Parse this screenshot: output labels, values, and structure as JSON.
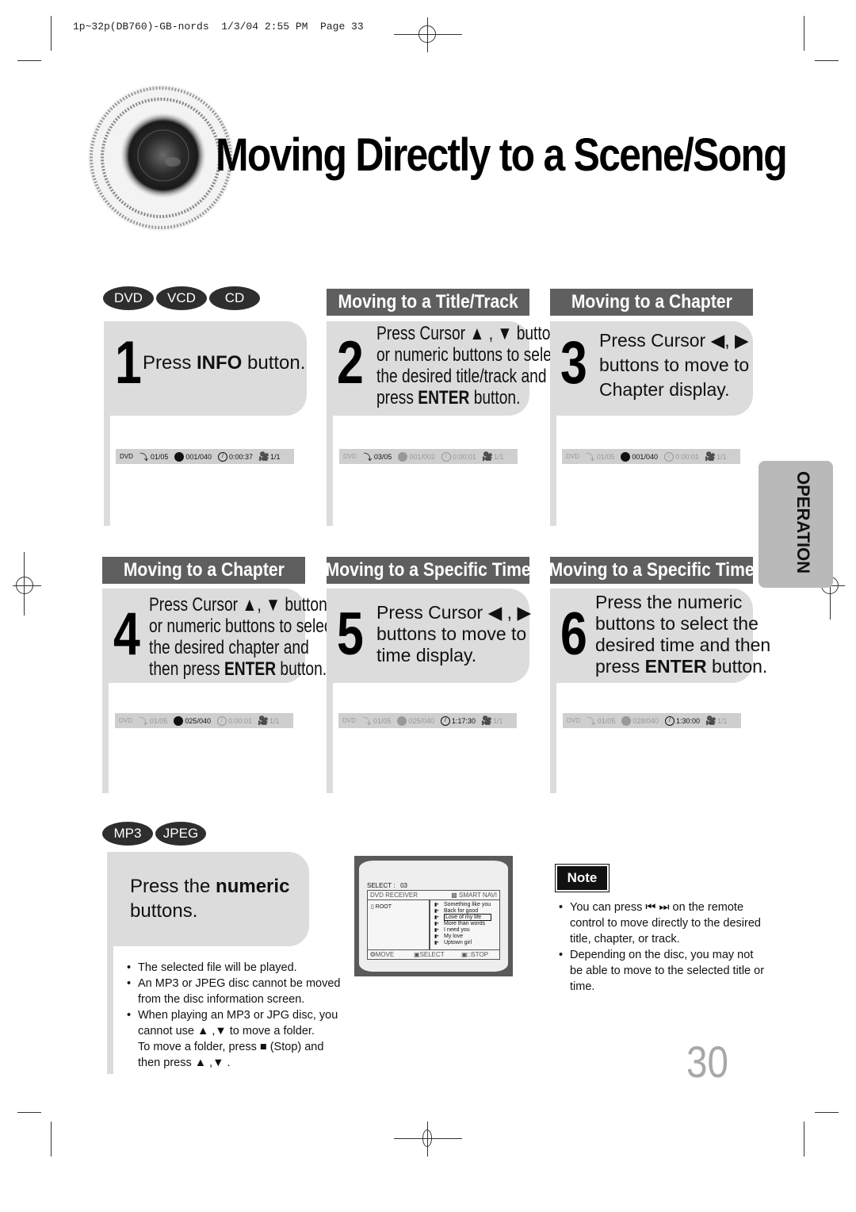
{
  "print_header": "1p~32p(DB760)-GB-nords  1/3/04 2:55 PM  Page 33",
  "page_title": "Moving Directly to a Scene/Song",
  "side_tab": "OPERATION",
  "page_number": "30",
  "disc_types_top": [
    "DVD",
    "VCD",
    "CD"
  ],
  "disc_types_bottom": [
    "MP3",
    "JPEG"
  ],
  "sections": {
    "title_track": "Moving to a Title/Track",
    "chapter_a": "Moving to a Chapter",
    "chapter_b": "Moving to a Chapter",
    "time_a": "Moving to a Specific Time",
    "time_b": "Moving to a Specific Time"
  },
  "steps": [
    {
      "num": "1",
      "pre": "Press ",
      "bold": "INFO",
      "post": " button."
    },
    {
      "num": "2",
      "line1": "Press Cursor ▲ , ▼ buttons",
      "line2": "or numeric buttons to select",
      "line3": "the desired title/track and then",
      "line4_pre": "press ",
      "line4_bold": "ENTER",
      "line4_post": " button."
    },
    {
      "num": "3",
      "line1": "Press Cursor ◀, ▶",
      "line2": "buttons to move to",
      "line3": "Chapter display."
    },
    {
      "num": "4",
      "line1": "Press Cursor ▲, ▼ buttons",
      "line2": "or numeric buttons to select",
      "line3": "the desired chapter and",
      "line4_pre": "then press ",
      "line4_bold": "ENTER",
      "line4_post": " button."
    },
    {
      "num": "5",
      "line1": "Press Cursor ◀ , ▶",
      "line2": "buttons to move to",
      "line3": "time display."
    },
    {
      "num": "6",
      "line1": "Press the numeric",
      "line2": "buttons to select the",
      "line3": "desired time and then",
      "line4_pre": "press ",
      "line4_bold": "ENTER",
      "line4_post": " button."
    }
  ],
  "osd": [
    {
      "disc": "DVD",
      "title": "01/05",
      "chapter": "001/040",
      "time": "0:00:37",
      "angle": "1/1",
      "active": "all"
    },
    {
      "disc": "DVD",
      "title": "03/05",
      "chapter": "001/002",
      "time": "0:00:01",
      "angle": "1/1",
      "active": "title"
    },
    {
      "disc": "DVD",
      "title": "01/05",
      "chapter": "001/040",
      "time": "0:00:01",
      "angle": "1/1",
      "active": "chapter"
    },
    {
      "disc": "DVD",
      "title": "01/05",
      "chapter": "025/040",
      "time": "0:00:01",
      "angle": "1/1",
      "active": "chapter"
    },
    {
      "disc": "DVD",
      "title": "01/05",
      "chapter": "025/040",
      "time": "1:17:30",
      "angle": "1/1",
      "active": "time"
    },
    {
      "disc": "DVD",
      "title": "01/05",
      "chapter": "028/040",
      "time": "1:30:00",
      "angle": "1/1",
      "active": "time"
    }
  ],
  "mp3_step": {
    "pre": "Press the ",
    "bold": "numeric",
    "line2": "buttons."
  },
  "mp3_screen": {
    "select_label": "SELECT :",
    "select_value": "03",
    "header_left": "DVD RECEIVER",
    "header_right": "SMART NAVI",
    "folder": "ROOT",
    "tracks": [
      "Something like you",
      "Back for good",
      "Love of my life",
      "More than words",
      "I need you",
      "My love",
      "Uptown girl"
    ],
    "selected_index": 2,
    "footer_move": "MOVE",
    "footer_select": "SELECT",
    "footer_stop": "STOP"
  },
  "mp3_bullets": {
    "b1": "The selected file will be played.",
    "b2_l1": "An MP3 or JPEG disc cannot be moved",
    "b2_l2": "from the disc information screen.",
    "b3_l1": "When playing an MP3 or JPG disc, you",
    "b3_l2": "cannot use ▲ ,▼   to move a folder.",
    "b3_l3": "To move a folder, press ■ (Stop) and",
    "b3_l4": "then press ▲ ,▼ ."
  },
  "note": {
    "label": "Note",
    "b1_l1": "You can press ⏮ ⏭ on the remote",
    "b1_l2": "control to move directly to the desired",
    "b1_l3": "title, chapter, or track.",
    "b2_l1": "Depending on the disc, you may not",
    "b2_l2": "be able to move to the selected title or",
    "b2_l3": "time."
  }
}
